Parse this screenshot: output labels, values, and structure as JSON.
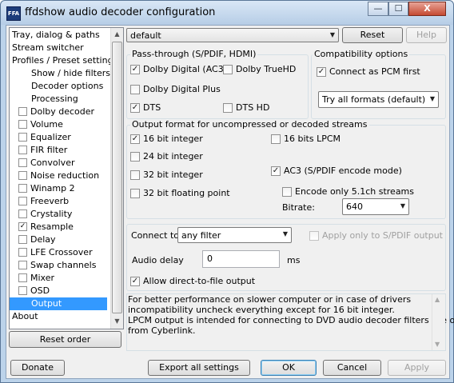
{
  "window": {
    "title": "ffdshow audio decoder configuration",
    "icon_label": "FFA",
    "controls": {
      "minimize": "—",
      "maximize": "☐",
      "close": "X"
    }
  },
  "sidebar": {
    "items": [
      {
        "label": "Tray, dialog & paths",
        "indent": 0,
        "checkbox": false,
        "checked": false,
        "selected": false
      },
      {
        "label": "Stream switcher",
        "indent": 0,
        "checkbox": false,
        "checked": false,
        "selected": false
      },
      {
        "label": "Profiles / Preset settings",
        "indent": 0,
        "checkbox": false,
        "checked": false,
        "selected": false
      },
      {
        "label": "Show / hide filters",
        "indent": 2,
        "checkbox": false,
        "checked": false,
        "selected": false
      },
      {
        "label": "Decoder options",
        "indent": 2,
        "checkbox": false,
        "checked": false,
        "selected": false
      },
      {
        "label": "Processing",
        "indent": 2,
        "checkbox": false,
        "checked": false,
        "selected": false
      },
      {
        "label": "Dolby decoder",
        "indent": 1,
        "checkbox": true,
        "checked": false,
        "selected": false
      },
      {
        "label": "Volume",
        "indent": 1,
        "checkbox": true,
        "checked": false,
        "selected": false
      },
      {
        "label": "Equalizer",
        "indent": 1,
        "checkbox": true,
        "checked": false,
        "selected": false
      },
      {
        "label": "FIR filter",
        "indent": 1,
        "checkbox": true,
        "checked": false,
        "selected": false
      },
      {
        "label": "Convolver",
        "indent": 1,
        "checkbox": true,
        "checked": false,
        "selected": false
      },
      {
        "label": "Noise reduction",
        "indent": 1,
        "checkbox": true,
        "checked": false,
        "selected": false
      },
      {
        "label": "Winamp 2",
        "indent": 1,
        "checkbox": true,
        "checked": false,
        "selected": false
      },
      {
        "label": "Freeverb",
        "indent": 1,
        "checkbox": true,
        "checked": false,
        "selected": false
      },
      {
        "label": "Crystality",
        "indent": 1,
        "checkbox": true,
        "checked": false,
        "selected": false
      },
      {
        "label": "Resample",
        "indent": 1,
        "checkbox": true,
        "checked": true,
        "selected": false
      },
      {
        "label": "Delay",
        "indent": 1,
        "checkbox": true,
        "checked": false,
        "selected": false
      },
      {
        "label": "LFE Crossover",
        "indent": 1,
        "checkbox": true,
        "checked": false,
        "selected": false
      },
      {
        "label": "Swap channels",
        "indent": 1,
        "checkbox": true,
        "checked": false,
        "selected": false
      },
      {
        "label": "Mixer",
        "indent": 1,
        "checkbox": true,
        "checked": false,
        "selected": false
      },
      {
        "label": "OSD",
        "indent": 1,
        "checkbox": true,
        "checked": false,
        "selected": false
      },
      {
        "label": "Output",
        "indent": 2,
        "checkbox": false,
        "checked": false,
        "selected": true
      },
      {
        "label": "About",
        "indent": 0,
        "checkbox": false,
        "checked": false,
        "selected": false
      }
    ],
    "reset_order_label": "Reset order"
  },
  "preset": {
    "value": "default",
    "reset_label": "Reset",
    "help_label": "Help"
  },
  "passthrough": {
    "title": "Pass-through (S/PDIF, HDMI)",
    "dolby_digital": {
      "label": "Dolby Digital (AC3)",
      "checked": true
    },
    "dolby_truehd": {
      "label": "Dolby TrueHD",
      "checked": false
    },
    "dolby_digital_plus": {
      "label": "Dolby Digital Plus",
      "checked": false
    },
    "dts": {
      "label": "DTS",
      "checked": true
    },
    "dts_hd": {
      "label": "DTS HD",
      "checked": false
    }
  },
  "compat": {
    "title": "Compatibility options",
    "connect_pcm": {
      "label": "Connect as PCM first",
      "checked": true
    },
    "formats_value": "Try all formats (default)"
  },
  "output_format": {
    "title": "Output format for uncompressed or decoded streams",
    "int16": {
      "label": "16 bit integer",
      "checked": true
    },
    "int24": {
      "label": "24 bit integer",
      "checked": false
    },
    "int32": {
      "label": "32 bit integer",
      "checked": false
    },
    "float32": {
      "label": "32 bit floating point",
      "checked": false
    },
    "lpcm16": {
      "label": "16 bits LPCM",
      "checked": false
    },
    "ac3": {
      "label": "AC3 (S/PDIF encode mode)",
      "checked": true
    },
    "encode51": {
      "label": "Encode only 5.1ch streams",
      "checked": false
    },
    "bitrate_label": "Bitrate:",
    "bitrate_value": "640"
  },
  "connect": {
    "label": "Connect to:",
    "value": "any filter",
    "spdif_only": {
      "label": "Apply only to S/PDIF output",
      "checked": false
    },
    "delay_label": "Audio delay",
    "delay_value": "0",
    "delay_unit": "ms",
    "direct_file": {
      "label": "Allow direct-to-file output",
      "checked": true
    }
  },
  "info": {
    "lines": [
      "For better performance on slower computer or in case of drivers",
      "incompatibility uncheck everything except for  16 bit integer.",
      "LPCM output is intended for connecting to DVD audio decoder filters like one",
      "from Cyberlink."
    ]
  },
  "footer": {
    "donate": "Donate",
    "export": "Export all settings",
    "ok": "OK",
    "cancel": "Cancel",
    "apply": "Apply"
  }
}
